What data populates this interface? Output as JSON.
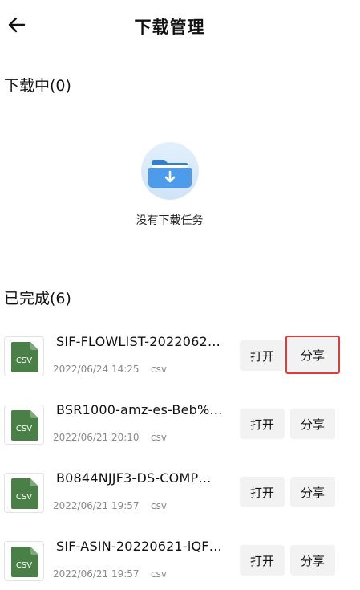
{
  "header": {
    "title": "下载管理"
  },
  "downloading": {
    "title": "下载中(0)",
    "empty_text": "没有下载任务"
  },
  "completed": {
    "title": "已完成(6)",
    "items": [
      {
        "name": "SIF-FLOWLIST-2022062…",
        "date": "2022/06/24 14:25",
        "type": "csv",
        "icon_label": "CSV",
        "open_label": "打开",
        "share_label": "分享"
      },
      {
        "name": "BSR1000-amz-es-Beb%…",
        "date": "2022/06/21 20:10",
        "type": "csv",
        "icon_label": "CSV",
        "open_label": "打开",
        "share_label": "分享"
      },
      {
        "name": "B0844NJJF3-DS-COMP…",
        "date": "2022/06/21 19:57",
        "type": "csv",
        "icon_label": "CSV",
        "open_label": "打开",
        "share_label": "分享"
      },
      {
        "name": "SIF-ASIN-20220621-iQF…",
        "date": "2022/06/21 19:57",
        "type": "csv",
        "icon_label": "CSV",
        "open_label": "打开",
        "share_label": "分享"
      }
    ]
  },
  "colors": {
    "csv_icon": "#4a7f47",
    "folder_light": "#d6e8fb",
    "folder_blue": "#3d8ee3",
    "highlight": "#e53935"
  },
  "icons": {
    "back": "arrow-left-icon",
    "empty": "folder-download-icon",
    "file": "csv-file-icon"
  }
}
